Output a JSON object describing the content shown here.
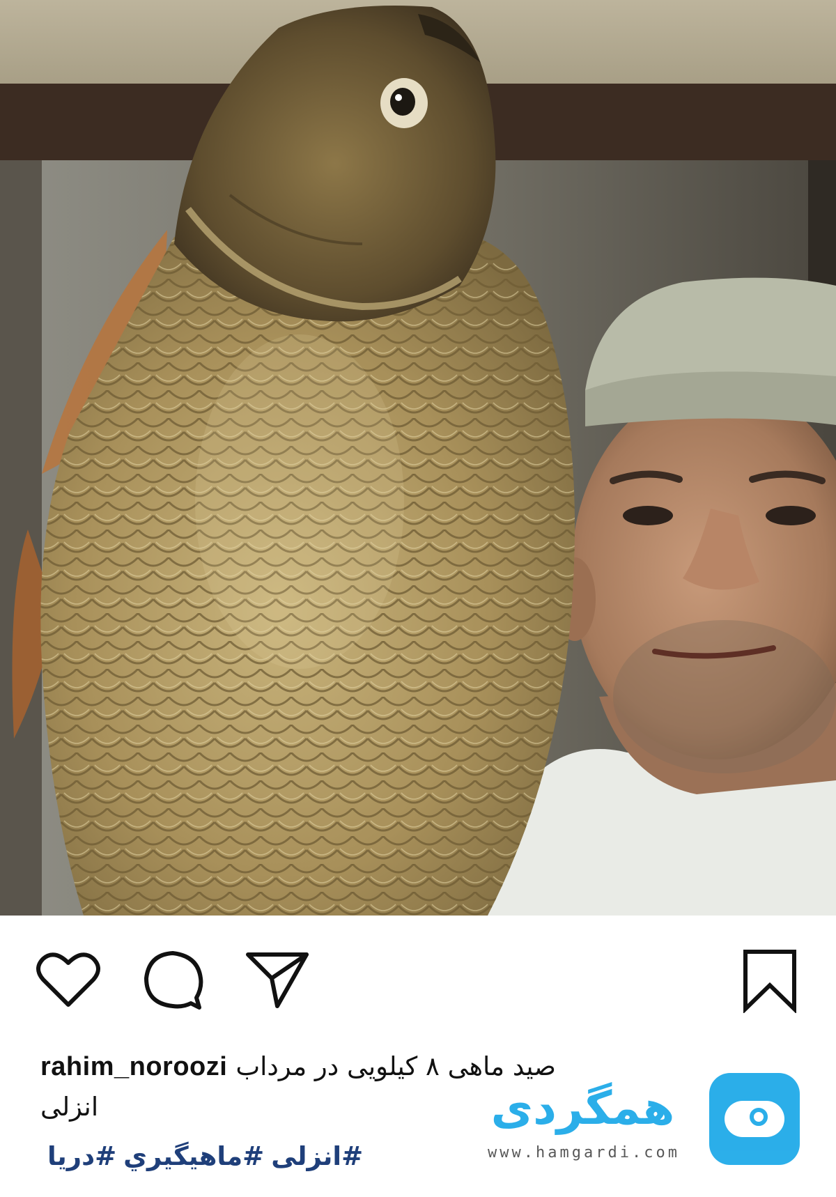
{
  "post": {
    "username": "rahim_noroozi",
    "caption_line1": "صید ماهی ۸ کیلویی در مرداب",
    "caption_line2": "انزلی",
    "hashtags": [
      "#انزلی",
      "#ماهيگيري",
      "#دريا"
    ]
  },
  "actions": {
    "like_icon": "heart-icon",
    "comment_icon": "comment-bubble-icon",
    "share_icon": "paper-plane-icon",
    "save_icon": "bookmark-icon"
  },
  "watermark": {
    "brand": "همگردی",
    "url": "www.hamgardi.com",
    "color": "#1aa8e8"
  },
  "colors": {
    "hashtag": "#1f3f7a",
    "text": "#111111",
    "background": "#ffffff"
  }
}
